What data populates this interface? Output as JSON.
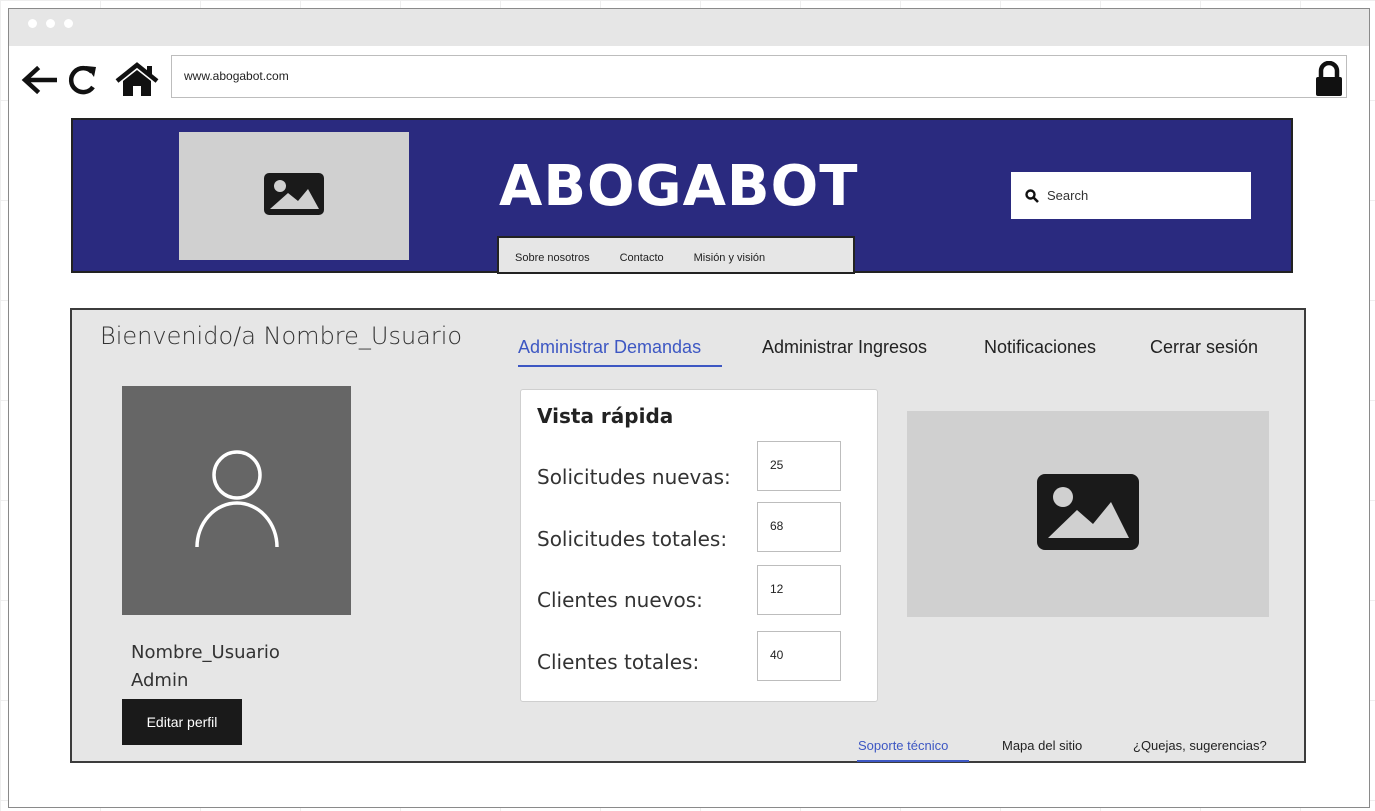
{
  "browser": {
    "url": "www.abogabot.com",
    "icons": {
      "back": "arrow-left-icon",
      "reload": "reload-icon",
      "home": "home-icon",
      "lock": "lock-icon"
    }
  },
  "header": {
    "brand": "ABOGABOT",
    "menu": [
      "Sobre nosotros",
      "Contacto",
      "Misión y visión"
    ],
    "search_placeholder": "Search",
    "colors": {
      "band": "#2a2a7f",
      "placeholder": "#d0d0d0"
    }
  },
  "main": {
    "welcome": "Bienvenido/a Nombre_Usuario",
    "tabs": [
      {
        "label": "Administrar Demandas",
        "active": true
      },
      {
        "label": "Administrar Ingresos",
        "active": false
      },
      {
        "label": "Notificaciones",
        "active": false
      },
      {
        "label": "Cerrar sesión",
        "active": false
      }
    ],
    "accent": "#3d57c3",
    "profile": {
      "name": "Nombre_Usuario",
      "role": "Admin",
      "edit_button": "Editar perfil"
    },
    "quick_view": {
      "title": "Vista rápida",
      "stats": [
        {
          "label": "Solicitudes nuevas:",
          "value": "25"
        },
        {
          "label": "Solicitudes totales:",
          "value": "68"
        },
        {
          "label": "Clientes nuevos:",
          "value": "12"
        },
        {
          "label": "Clientes totales:",
          "value": "40"
        }
      ]
    },
    "footer_links": [
      {
        "label": "Soporte técnico",
        "active": true
      },
      {
        "label": "Mapa del sitio",
        "active": false
      },
      {
        "label": "¿Quejas, sugerencias?",
        "active": false
      }
    ]
  }
}
